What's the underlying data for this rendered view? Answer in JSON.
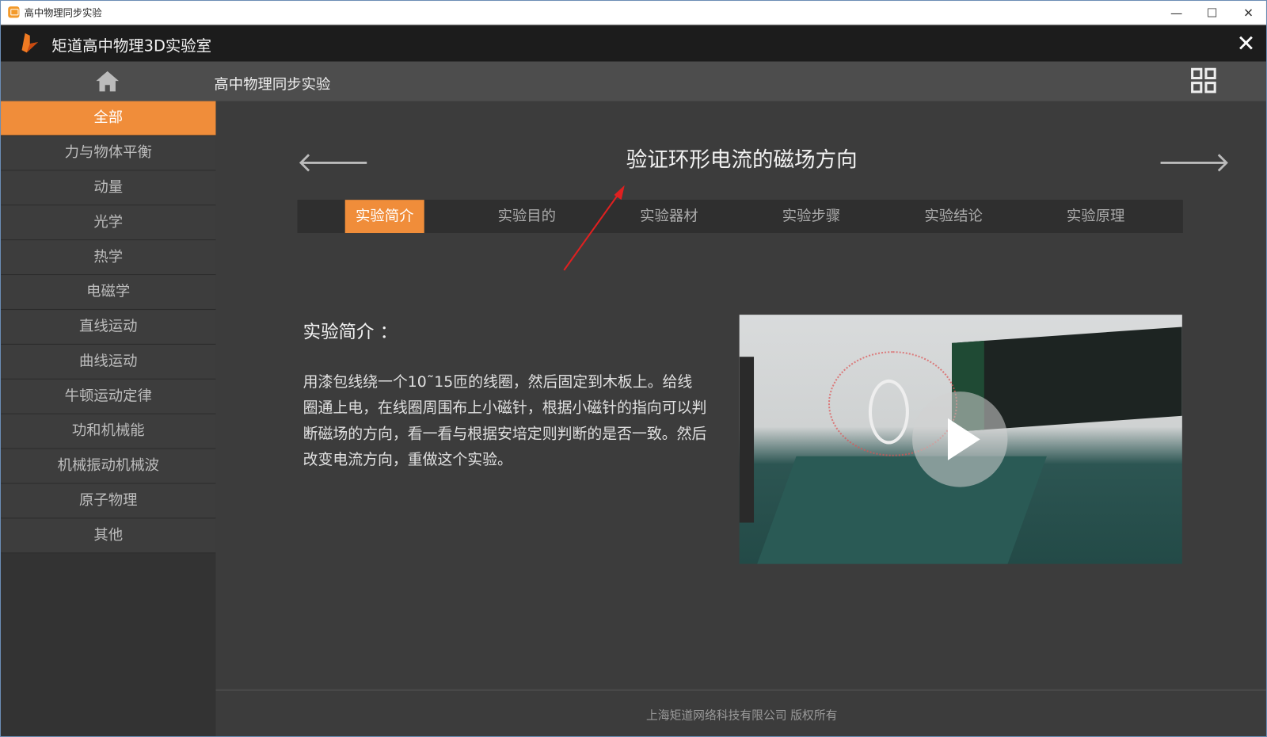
{
  "window": {
    "title": "高中物理同步实验",
    "minimize": "—",
    "maximize": "☐",
    "close": "✕"
  },
  "app": {
    "title": "矩道高中物理3D实验室",
    "close": "✕"
  },
  "nav": {
    "title": "高中物理同步实验"
  },
  "sidebar": {
    "items": [
      {
        "label": "全部",
        "active": true
      },
      {
        "label": "力与物体平衡"
      },
      {
        "label": "动量"
      },
      {
        "label": "光学"
      },
      {
        "label": "热学"
      },
      {
        "label": "电磁学"
      },
      {
        "label": "直线运动"
      },
      {
        "label": "曲线运动"
      },
      {
        "label": "牛顿运动定律"
      },
      {
        "label": "功和机械能"
      },
      {
        "label": "机械振动机械波"
      },
      {
        "label": "原子物理"
      },
      {
        "label": "其他"
      }
    ]
  },
  "main": {
    "prev": "🡐",
    "next": "🡒",
    "title": "验证环形电流的磁场方向",
    "tabs": [
      {
        "label": "实验简介",
        "active": true
      },
      {
        "label": "实验目的"
      },
      {
        "label": "实验器材"
      },
      {
        "label": "实验步骤"
      },
      {
        "label": "实验结论"
      },
      {
        "label": "实验原理"
      }
    ],
    "section_title": "实验简介 ：",
    "description": "用漆包线绕一个10˜15匝的线圈，然后固定到木板上。给线圈通上电，在线圈周围布上小磁针，根据小磁针的指向可以判断磁场的方向，看一看与根据安培定则判断的是否一致。然后改变电流方向，重做这个实验。"
  },
  "footer": {
    "copyright": "上海矩道网络科技有限公司  版权所有"
  },
  "colors": {
    "accent": "#f08d3a",
    "annotation_arrow": "#e02020"
  }
}
